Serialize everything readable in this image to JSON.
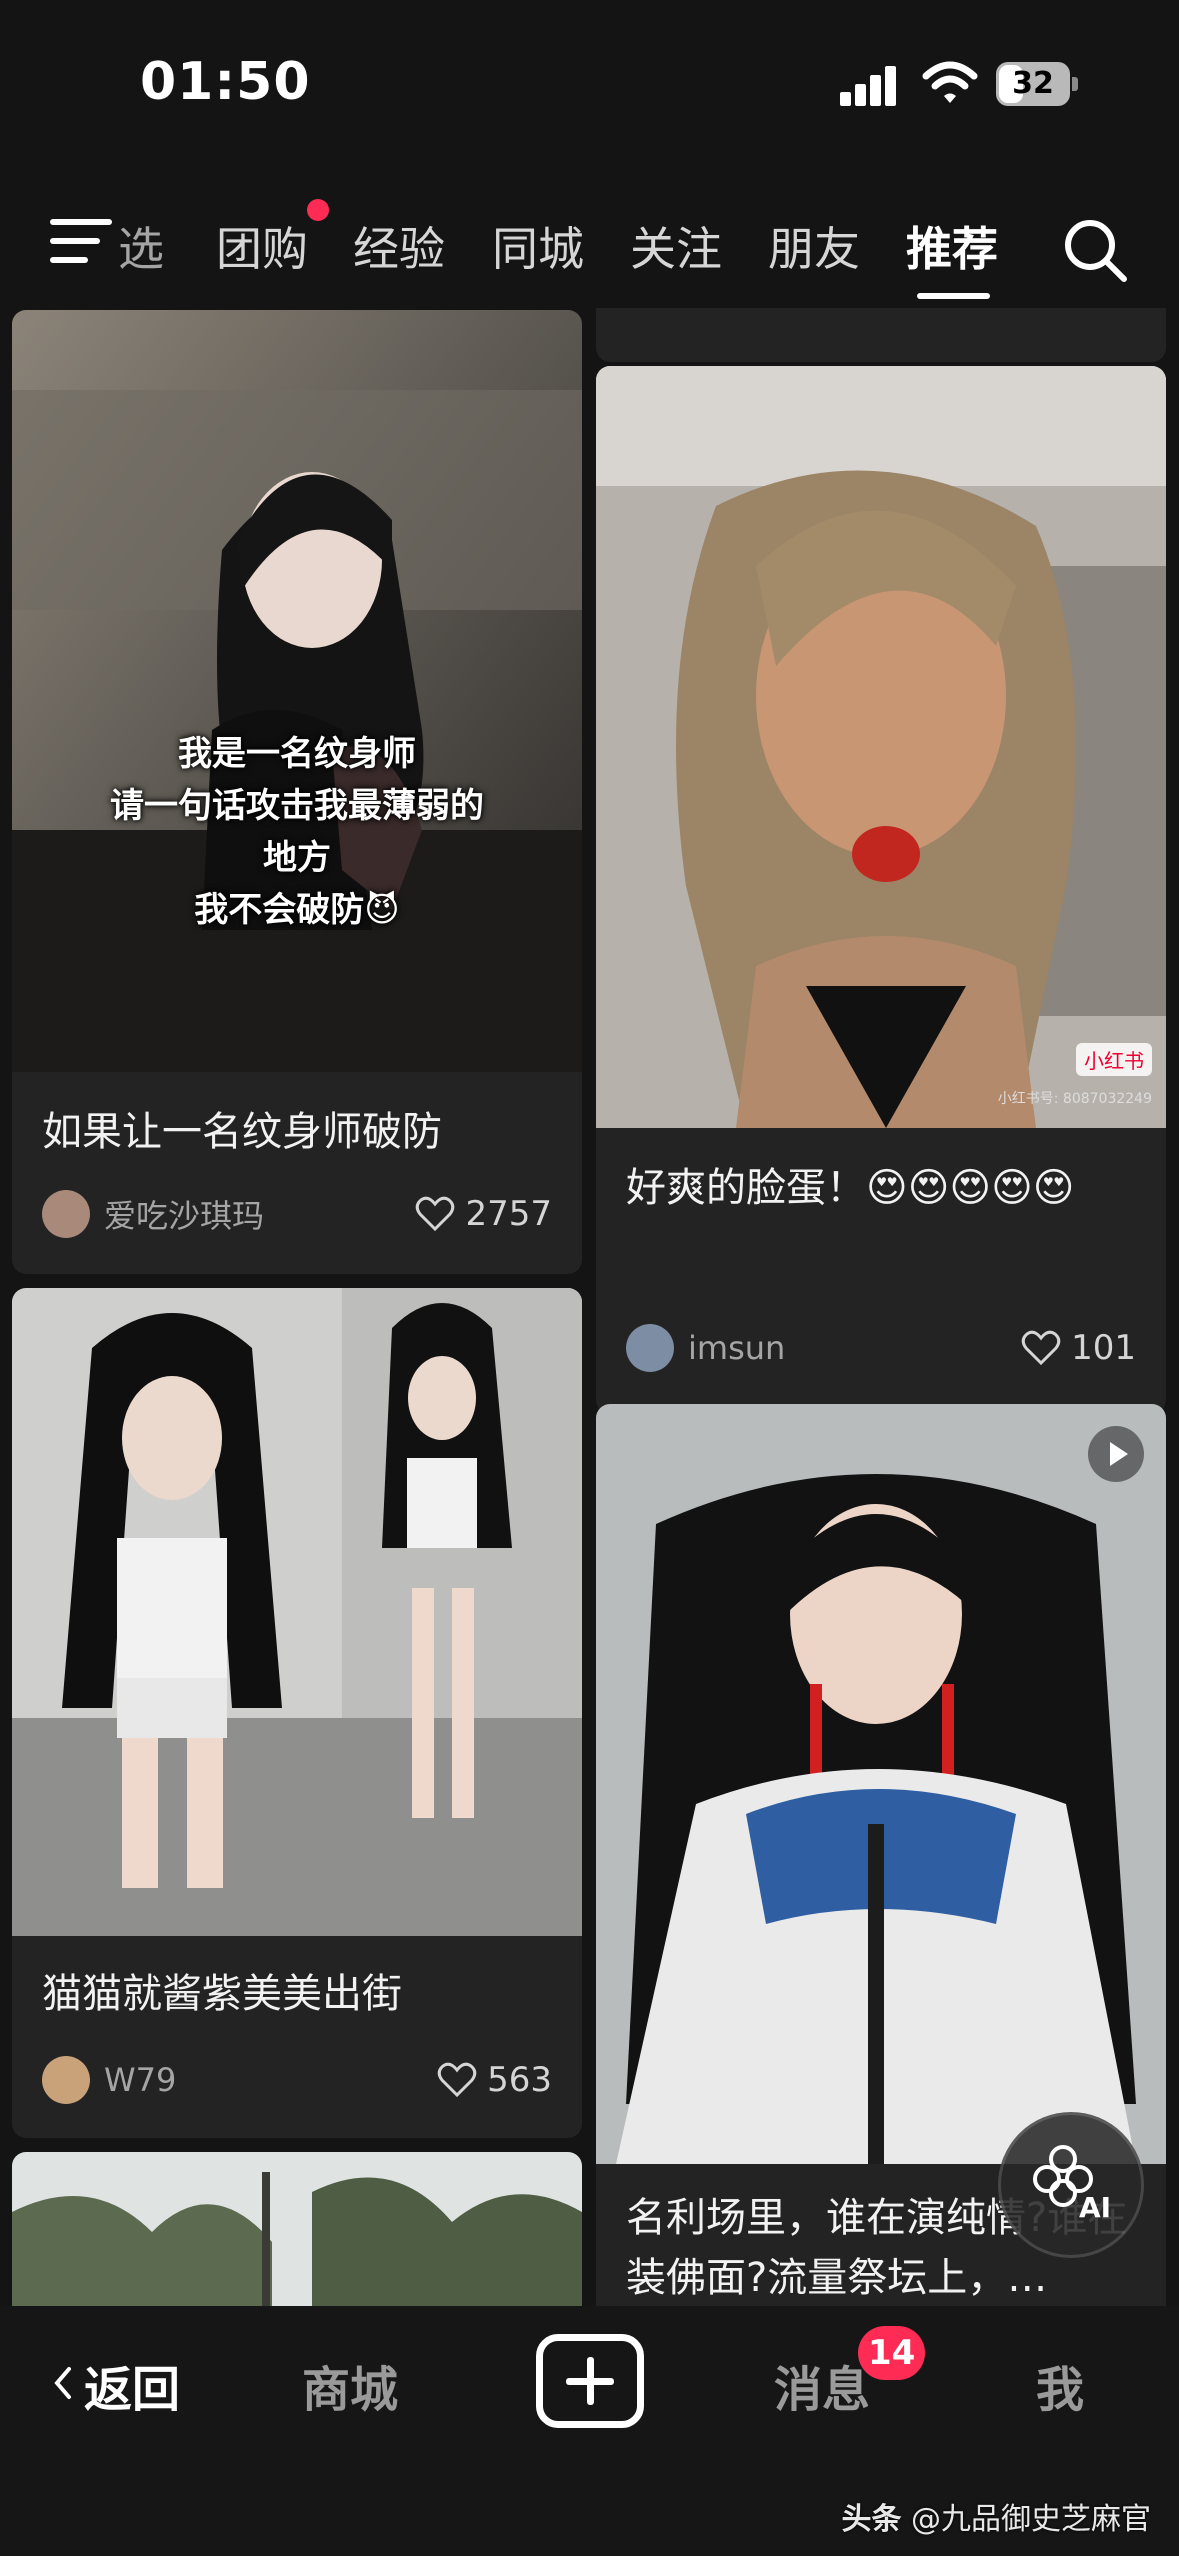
{
  "status_bar": {
    "time": "01:50",
    "battery_level": "32"
  },
  "top_nav": {
    "partial_tab": "选",
    "tabs": [
      "团购",
      "经验",
      "同城",
      "关注",
      "朋友",
      "推荐"
    ],
    "active_tab": "推荐"
  },
  "feed": {
    "cards": [
      {
        "title": "如果让一名纹身师破防",
        "author": "爱吃沙琪玛",
        "likes": "2757",
        "overlay_lines": [
          "我是一名纹身师",
          "请一句话攻击我最薄弱的",
          "地方",
          "我不会破防😈"
        ]
      },
      {
        "title": "好爽的脸蛋！😍😍😍😍😍",
        "author": "imsun",
        "likes": "101",
        "watermark": "小红书",
        "watermark_id": "小红书号: 8087032249"
      },
      {
        "title": "猫猫就酱紫美美出街",
        "author": "W79",
        "likes": "563"
      },
      {
        "title": "名利场里，谁在演纯情?谁在装佛面?流量祭坛上，…"
      }
    ]
  },
  "ai_button": {
    "label": "AI"
  },
  "bottom_nav": {
    "back": "返回",
    "mall": "商城",
    "messages": "消息",
    "messages_badge": "14",
    "me": "我"
  },
  "credit": {
    "source": "头条",
    "author": "@九品御史芝麻官"
  }
}
